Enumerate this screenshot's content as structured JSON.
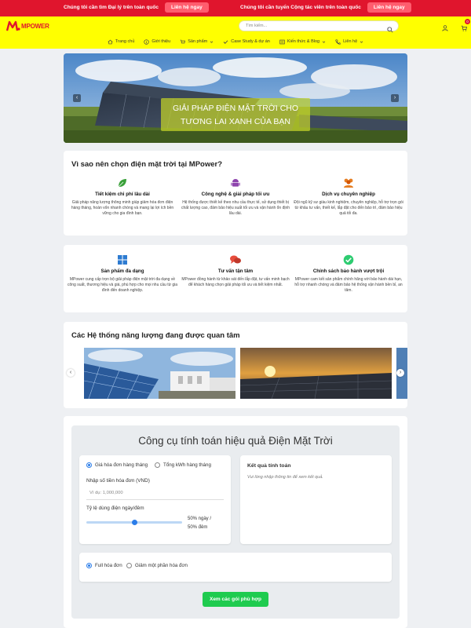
{
  "topbar": {
    "left_message": "Chúng tôi cần tìm Đại lý trên toàn quốc",
    "left_button": "Liên hệ ngay",
    "right_message": "Chúng tôi cần tuyển Cộng tác viên trên toàn quốc",
    "right_button": "Liên hệ ngay"
  },
  "header": {
    "logo_text": "MPOWER",
    "search_placeholder": "Tìm kiếm...",
    "cart_count": "0"
  },
  "nav": {
    "items": [
      {
        "label": "Trang chủ",
        "icon": "home-icon"
      },
      {
        "label": "Giới thiệu",
        "icon": "info-icon"
      },
      {
        "label": "Sản phẩm",
        "icon": "cart-icon"
      },
      {
        "label": "Case Study & dự án",
        "icon": "check-icon"
      },
      {
        "label": "Kiến thức & Blog",
        "icon": "blog-icon"
      },
      {
        "label": "Liên hệ",
        "icon": "phone-icon"
      }
    ]
  },
  "hero": {
    "caption_line1": "GIẢI PHÁP ĐIỆN MẶT TRỜI CHO",
    "caption_line2": "TƯƠNG LAI XANH CỦA BẠN",
    "prev": "‹",
    "next": "›"
  },
  "why": {
    "title": "Vì sao nên chọn điện mặt trời tại MPower?",
    "features": [
      {
        "title": "Tiết kiệm chi phí lâu dài",
        "desc": "Giải pháp năng lượng thông minh giúp giảm hóa đơn điện hàng tháng, hoàn vốn nhanh chóng và mang lại lợi ích bền vững cho gia đình bạn.",
        "icon": "leaf-icon",
        "color": "#3aa13a"
      },
      {
        "title": "Công nghệ & giải pháp tối ưu",
        "desc": "Hệ thống được thiết kế theo nhu cầu thực tế, sử dụng thiết bị chất lượng cao, đảm bảo hiệu suất tối ưu và vận hành ổn định lâu dài.",
        "icon": "android-icon",
        "color": "#8e44ad"
      },
      {
        "title": "Dịch vụ chuyên nghiệp",
        "desc": "Đội ngũ kỹ sư giàu kinh nghiệm, chuyên nghiệp, hỗ trợ trọn gói từ khâu tư vấn, thiết kế, lắp đặt cho đến bảo trì, đảm bảo hiệu quả tối đa.",
        "icon": "users-icon",
        "color": "#e67e22"
      },
      {
        "title": "Sản phẩm đa dạng",
        "desc": "MPower cung cấp trọn bộ giải pháp điện mặt trời đa dạng về công suất, thương hiệu và giá, phù hợp cho mọi nhu cầu từ gia đình đến doanh nghiệp.",
        "icon": "grid-icon",
        "color": "#2d7bd1"
      },
      {
        "title": "Tư vấn tận tâm",
        "desc": "MPower đồng hành từ khảo sát đến lắp đặt, tư vấn minh bạch để khách hàng chọn giải pháp tối ưu và tiết kiệm nhất.",
        "icon": "chat-icon",
        "color": "#e74c3c"
      },
      {
        "title": "Chính sách bảo hành vượt trội",
        "desc": "MPower cam kết sản phẩm chính hãng với bảo hành dài hạn, hỗ trợ nhanh chóng và đảm bảo hệ thống vận hành bền bỉ, an tâm.",
        "icon": "check-circle-icon",
        "color": "#2ecc71"
      }
    ]
  },
  "systems": {
    "title": "Các Hệ thống năng lượng đang được quan tâm",
    "prev": "‹",
    "next": "›"
  },
  "calculator": {
    "title": "Công cụ tính toán hiệu quả Điện Mặt Trời",
    "mode_options": [
      "Giá hóa đơn hàng tháng",
      "Tổng kWh hàng tháng"
    ],
    "mode_selected": 0,
    "bill_label": "Nhập số tiền hóa đơn (VND)",
    "bill_placeholder": "Ví dụ: 1,000,000",
    "ratio_label": "Tỷ lệ dùng điện ngày/đêm",
    "ratio_text_line1": "50% ngày /",
    "ratio_text_line2": "50% đêm",
    "ratio_day_percent": 50,
    "result_title": "Kết quả tính toán",
    "result_hint": "Vui lòng nhập thông tin để xem kết quả.",
    "scope_options": [
      "Full hóa đơn",
      "Giảm một phần hóa đơn"
    ],
    "scope_selected": 0,
    "submit_label": "Xem các gói phù hợp"
  },
  "colors": {
    "topbar": "#e0152d",
    "header": "#ffff00",
    "accent": "#2b7de9",
    "submit": "#1fcb4f"
  }
}
